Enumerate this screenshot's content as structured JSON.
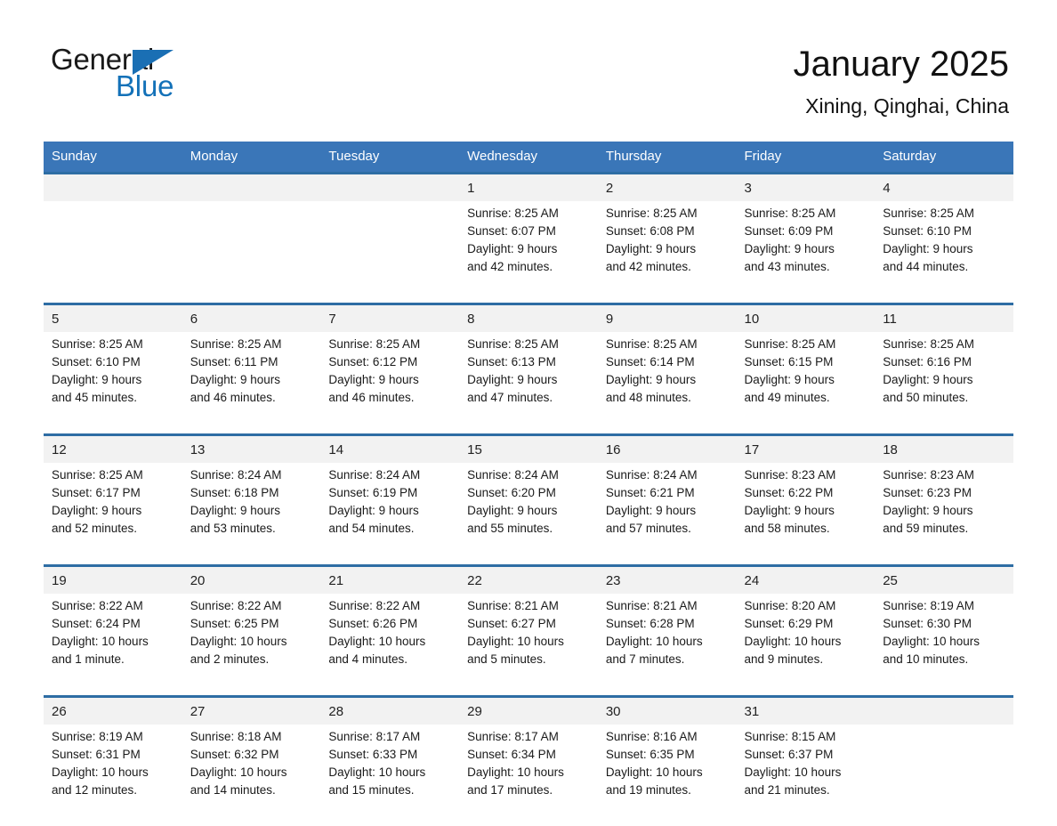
{
  "brand": {
    "name_part1": "General",
    "name_part2": "Blue",
    "triangle_color": "#1a6fb4",
    "blue_color": "#1371b8"
  },
  "header": {
    "title": "January 2025",
    "location": "Xining, Qinghai, China",
    "header_bg": "#3a76b8",
    "row_divider_color": "#2e6da4",
    "date_band_bg": "#f2f2f2"
  },
  "weekdays": [
    "Sunday",
    "Monday",
    "Tuesday",
    "Wednesday",
    "Thursday",
    "Friday",
    "Saturday"
  ],
  "weeks": [
    {
      "dates": [
        "",
        "",
        "",
        "1",
        "2",
        "3",
        "4"
      ],
      "cells": [
        {
          "empty": true
        },
        {
          "empty": true
        },
        {
          "empty": true
        },
        {
          "sunrise": "Sunrise: 8:25 AM",
          "sunset": "Sunset: 6:07 PM",
          "daylight1": "Daylight: 9 hours",
          "daylight2": "and 42 minutes."
        },
        {
          "sunrise": "Sunrise: 8:25 AM",
          "sunset": "Sunset: 6:08 PM",
          "daylight1": "Daylight: 9 hours",
          "daylight2": "and 42 minutes."
        },
        {
          "sunrise": "Sunrise: 8:25 AM",
          "sunset": "Sunset: 6:09 PM",
          "daylight1": "Daylight: 9 hours",
          "daylight2": "and 43 minutes."
        },
        {
          "sunrise": "Sunrise: 8:25 AM",
          "sunset": "Sunset: 6:10 PM",
          "daylight1": "Daylight: 9 hours",
          "daylight2": "and 44 minutes."
        }
      ]
    },
    {
      "dates": [
        "5",
        "6",
        "7",
        "8",
        "9",
        "10",
        "11"
      ],
      "cells": [
        {
          "sunrise": "Sunrise: 8:25 AM",
          "sunset": "Sunset: 6:10 PM",
          "daylight1": "Daylight: 9 hours",
          "daylight2": "and 45 minutes."
        },
        {
          "sunrise": "Sunrise: 8:25 AM",
          "sunset": "Sunset: 6:11 PM",
          "daylight1": "Daylight: 9 hours",
          "daylight2": "and 46 minutes."
        },
        {
          "sunrise": "Sunrise: 8:25 AM",
          "sunset": "Sunset: 6:12 PM",
          "daylight1": "Daylight: 9 hours",
          "daylight2": "and 46 minutes."
        },
        {
          "sunrise": "Sunrise: 8:25 AM",
          "sunset": "Sunset: 6:13 PM",
          "daylight1": "Daylight: 9 hours",
          "daylight2": "and 47 minutes."
        },
        {
          "sunrise": "Sunrise: 8:25 AM",
          "sunset": "Sunset: 6:14 PM",
          "daylight1": "Daylight: 9 hours",
          "daylight2": "and 48 minutes."
        },
        {
          "sunrise": "Sunrise: 8:25 AM",
          "sunset": "Sunset: 6:15 PM",
          "daylight1": "Daylight: 9 hours",
          "daylight2": "and 49 minutes."
        },
        {
          "sunrise": "Sunrise: 8:25 AM",
          "sunset": "Sunset: 6:16 PM",
          "daylight1": "Daylight: 9 hours",
          "daylight2": "and 50 minutes."
        }
      ]
    },
    {
      "dates": [
        "12",
        "13",
        "14",
        "15",
        "16",
        "17",
        "18"
      ],
      "cells": [
        {
          "sunrise": "Sunrise: 8:25 AM",
          "sunset": "Sunset: 6:17 PM",
          "daylight1": "Daylight: 9 hours",
          "daylight2": "and 52 minutes."
        },
        {
          "sunrise": "Sunrise: 8:24 AM",
          "sunset": "Sunset: 6:18 PM",
          "daylight1": "Daylight: 9 hours",
          "daylight2": "and 53 minutes."
        },
        {
          "sunrise": "Sunrise: 8:24 AM",
          "sunset": "Sunset: 6:19 PM",
          "daylight1": "Daylight: 9 hours",
          "daylight2": "and 54 minutes."
        },
        {
          "sunrise": "Sunrise: 8:24 AM",
          "sunset": "Sunset: 6:20 PM",
          "daylight1": "Daylight: 9 hours",
          "daylight2": "and 55 minutes."
        },
        {
          "sunrise": "Sunrise: 8:24 AM",
          "sunset": "Sunset: 6:21 PM",
          "daylight1": "Daylight: 9 hours",
          "daylight2": "and 57 minutes."
        },
        {
          "sunrise": "Sunrise: 8:23 AM",
          "sunset": "Sunset: 6:22 PM",
          "daylight1": "Daylight: 9 hours",
          "daylight2": "and 58 minutes."
        },
        {
          "sunrise": "Sunrise: 8:23 AM",
          "sunset": "Sunset: 6:23 PM",
          "daylight1": "Daylight: 9 hours",
          "daylight2": "and 59 minutes."
        }
      ]
    },
    {
      "dates": [
        "19",
        "20",
        "21",
        "22",
        "23",
        "24",
        "25"
      ],
      "cells": [
        {
          "sunrise": "Sunrise: 8:22 AM",
          "sunset": "Sunset: 6:24 PM",
          "daylight1": "Daylight: 10 hours",
          "daylight2": "and 1 minute."
        },
        {
          "sunrise": "Sunrise: 8:22 AM",
          "sunset": "Sunset: 6:25 PM",
          "daylight1": "Daylight: 10 hours",
          "daylight2": "and 2 minutes."
        },
        {
          "sunrise": "Sunrise: 8:22 AM",
          "sunset": "Sunset: 6:26 PM",
          "daylight1": "Daylight: 10 hours",
          "daylight2": "and 4 minutes."
        },
        {
          "sunrise": "Sunrise: 8:21 AM",
          "sunset": "Sunset: 6:27 PM",
          "daylight1": "Daylight: 10 hours",
          "daylight2": "and 5 minutes."
        },
        {
          "sunrise": "Sunrise: 8:21 AM",
          "sunset": "Sunset: 6:28 PM",
          "daylight1": "Daylight: 10 hours",
          "daylight2": "and 7 minutes."
        },
        {
          "sunrise": "Sunrise: 8:20 AM",
          "sunset": "Sunset: 6:29 PM",
          "daylight1": "Daylight: 10 hours",
          "daylight2": "and 9 minutes."
        },
        {
          "sunrise": "Sunrise: 8:19 AM",
          "sunset": "Sunset: 6:30 PM",
          "daylight1": "Daylight: 10 hours",
          "daylight2": "and 10 minutes."
        }
      ]
    },
    {
      "dates": [
        "26",
        "27",
        "28",
        "29",
        "30",
        "31",
        ""
      ],
      "cells": [
        {
          "sunrise": "Sunrise: 8:19 AM",
          "sunset": "Sunset: 6:31 PM",
          "daylight1": "Daylight: 10 hours",
          "daylight2": "and 12 minutes."
        },
        {
          "sunrise": "Sunrise: 8:18 AM",
          "sunset": "Sunset: 6:32 PM",
          "daylight1": "Daylight: 10 hours",
          "daylight2": "and 14 minutes."
        },
        {
          "sunrise": "Sunrise: 8:17 AM",
          "sunset": "Sunset: 6:33 PM",
          "daylight1": "Daylight: 10 hours",
          "daylight2": "and 15 minutes."
        },
        {
          "sunrise": "Sunrise: 8:17 AM",
          "sunset": "Sunset: 6:34 PM",
          "daylight1": "Daylight: 10 hours",
          "daylight2": "and 17 minutes."
        },
        {
          "sunrise": "Sunrise: 8:16 AM",
          "sunset": "Sunset: 6:35 PM",
          "daylight1": "Daylight: 10 hours",
          "daylight2": "and 19 minutes."
        },
        {
          "sunrise": "Sunrise: 8:15 AM",
          "sunset": "Sunset: 6:37 PM",
          "daylight1": "Daylight: 10 hours",
          "daylight2": "and 21 minutes."
        },
        {
          "empty": true
        }
      ]
    }
  ]
}
